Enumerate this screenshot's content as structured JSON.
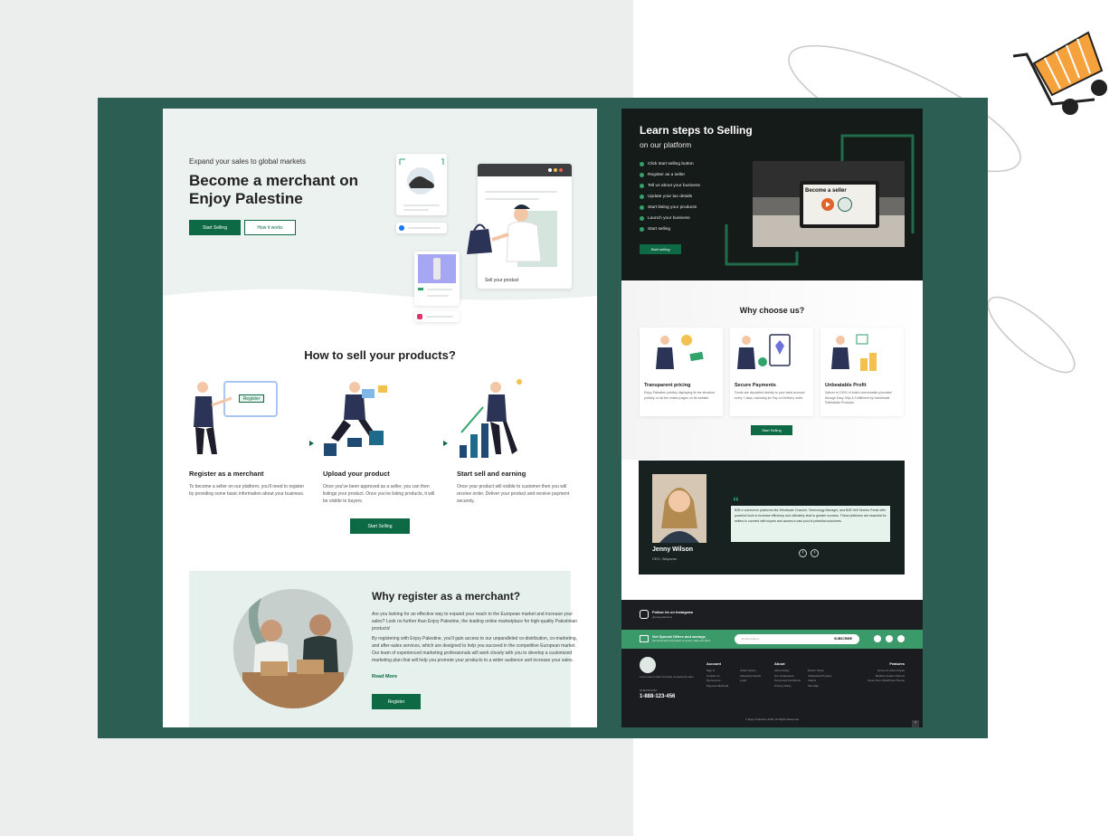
{
  "merchant_page": {
    "eyebrow": "Expand your sales to global markets",
    "hero_title": "Become a merchant on Enjoy Palestine",
    "start_selling_label": "Start Selling",
    "how_it_works_label": "How it works",
    "sell_card_caption": "Sell your product",
    "how_title": "How to sell your products?",
    "steps": [
      {
        "title": "Register as a merchant",
        "desc": "To become a seller on our platform, you'll need to register by providing some basic information about your business.",
        "sign_label": "Register"
      },
      {
        "title": "Upload your product",
        "desc": "Once you've been approved as a seller, you can then listings your product. Once you've listing products, it will be visible to buyers."
      },
      {
        "title": "Start sell and earning",
        "desc": "Once your product will visible to customer then you will receive order. Deliver your product and receive payment securely."
      }
    ],
    "start_selling_mid_label": "Start Selling",
    "why_title": "Why register as a merchant?",
    "why_p1": "Are you looking for an effective way to expand your reach to the European market and increase your sales? Look no further than Enjoy Palestine, the leading online marketplace for high-quality Palestinian products!",
    "why_p2": "By registering with Enjoy Palestine, you'll gain access to our unparalleled co-distribution, co-marketing, and after-sales services, which are designed to help you succeed in the competitive European market. Our team of experienced marketing professionals will work closely with you to develop a customized marketing plan that will help you promote your products to a wider audience and increase your sales.",
    "read_more_label": "Read More",
    "register_label": "Register"
  },
  "steps_page": {
    "title": "Learn steps to Selling",
    "subtitle": "on our platform",
    "checklist": [
      "Click start selling button",
      "Register as a seller",
      "Tell us about your business",
      "Update your tax details",
      "Start listing your products",
      "Launch your business",
      "Start selling"
    ],
    "start_selling_label": "Start selling",
    "video_text": "Become a seller",
    "why_choose_title": "Why choose us?",
    "features": [
      {
        "title": "Transparent pricing",
        "desc": "Enjoy Palestine publicly displaying its fee structure publicly on all the related pages on its website."
      },
      {
        "title": "Secure Payments",
        "desc": "Funds are deposited directly to your bank account every 7 days, including for Pay on Delivery order."
      },
      {
        "title": "Unbeatable Profit",
        "desc": "Deliver to 100% of India's serviceable pincodes* through Easy Ship & Fulfillment by Handmade Palestinian Products."
      }
    ],
    "start_selling_2_label": "Start Selling",
    "testimonial": {
      "quote": "B2B e-commerce platforms like Wholesale Channel, Technology Manager, and B2B Self Service Portal offer powerful tools to increase efficiency and ultimately lead to greater success. These platforms are essential for sellers to connect with buyers and access a vast pool of potential customers.",
      "name": "Jenny Wilson",
      "role": "CEO, Wayscus"
    },
    "instagram": {
      "title": "Follow Us on Instagram",
      "handle": "@enjoypalestine"
    },
    "subscribe": {
      "title": "Get Special Offers and savings",
      "sub": "Get all the latest information on events, sales and offers.",
      "placeholder": "Email Address",
      "button": "SUBSCRIBE"
    },
    "footer": {
      "about_text": "Lorem ipsum dolor sit amet consectetur elitm.",
      "phone_label": "QUESTIONS?",
      "phone": "1-888-123-456",
      "account_title": "Account",
      "account_items": [
        "Sign In",
        "Contact us",
        "My Account",
        "Payment Methods"
      ],
      "account_items_2": [
        "Order History",
        "Advanced search",
        "Login"
      ],
      "about_title": "About",
      "about_items": [
        "About Policy",
        "Our Guarantees",
        "Terms and Conditions",
        "Privacy Policy"
      ],
      "about_items_2": [
        "Return Policy",
        "Intellectual Property",
        "Claims",
        "Site Map"
      ],
      "features_title": "Features",
      "features_items": [
        "Home for Admin Panel",
        "Module Custom Options",
        "Impex Dom WordPress Theme"
      ],
      "copyright": "© Enjoy Palestine 2023. All Rights Reserved"
    }
  },
  "colors": {
    "brand_green": "#0e6a44",
    "frame_green": "#2d5e53",
    "dark": "#151b19",
    "cart_orange": "#f5a23c"
  }
}
